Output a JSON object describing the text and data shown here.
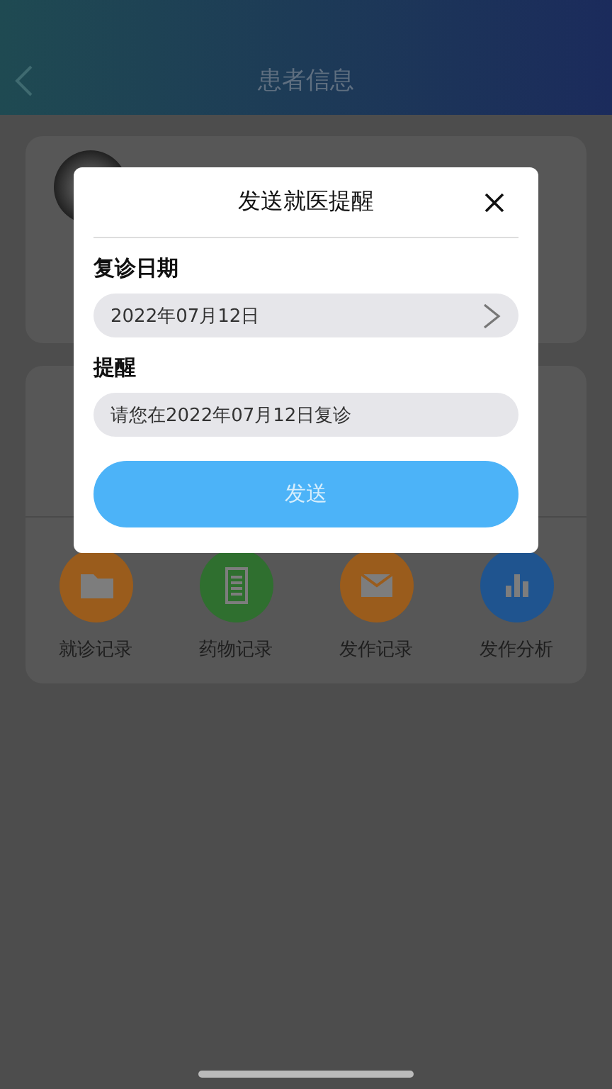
{
  "header": {
    "title": "患者信息"
  },
  "menu": [
    {
      "label": "就诊记录",
      "kind": "folder",
      "color": "#9a5c1c"
    },
    {
      "label": "药物记录",
      "kind": "list",
      "color": "#2f6f2f"
    },
    {
      "label": "发作记录",
      "kind": "mail",
      "color": "#9a5c1c"
    },
    {
      "label": "发作分析",
      "kind": "chart",
      "color": "#1f548f"
    }
  ],
  "dialog": {
    "title": "发送就医提醒",
    "fields": [
      {
        "label": "复诊日期",
        "value": "2022年07月12日",
        "kind": "picker"
      },
      {
        "label": "提醒",
        "value": "请您在2022年07月12日复诊",
        "kind": "text"
      }
    ],
    "button": "发送"
  }
}
